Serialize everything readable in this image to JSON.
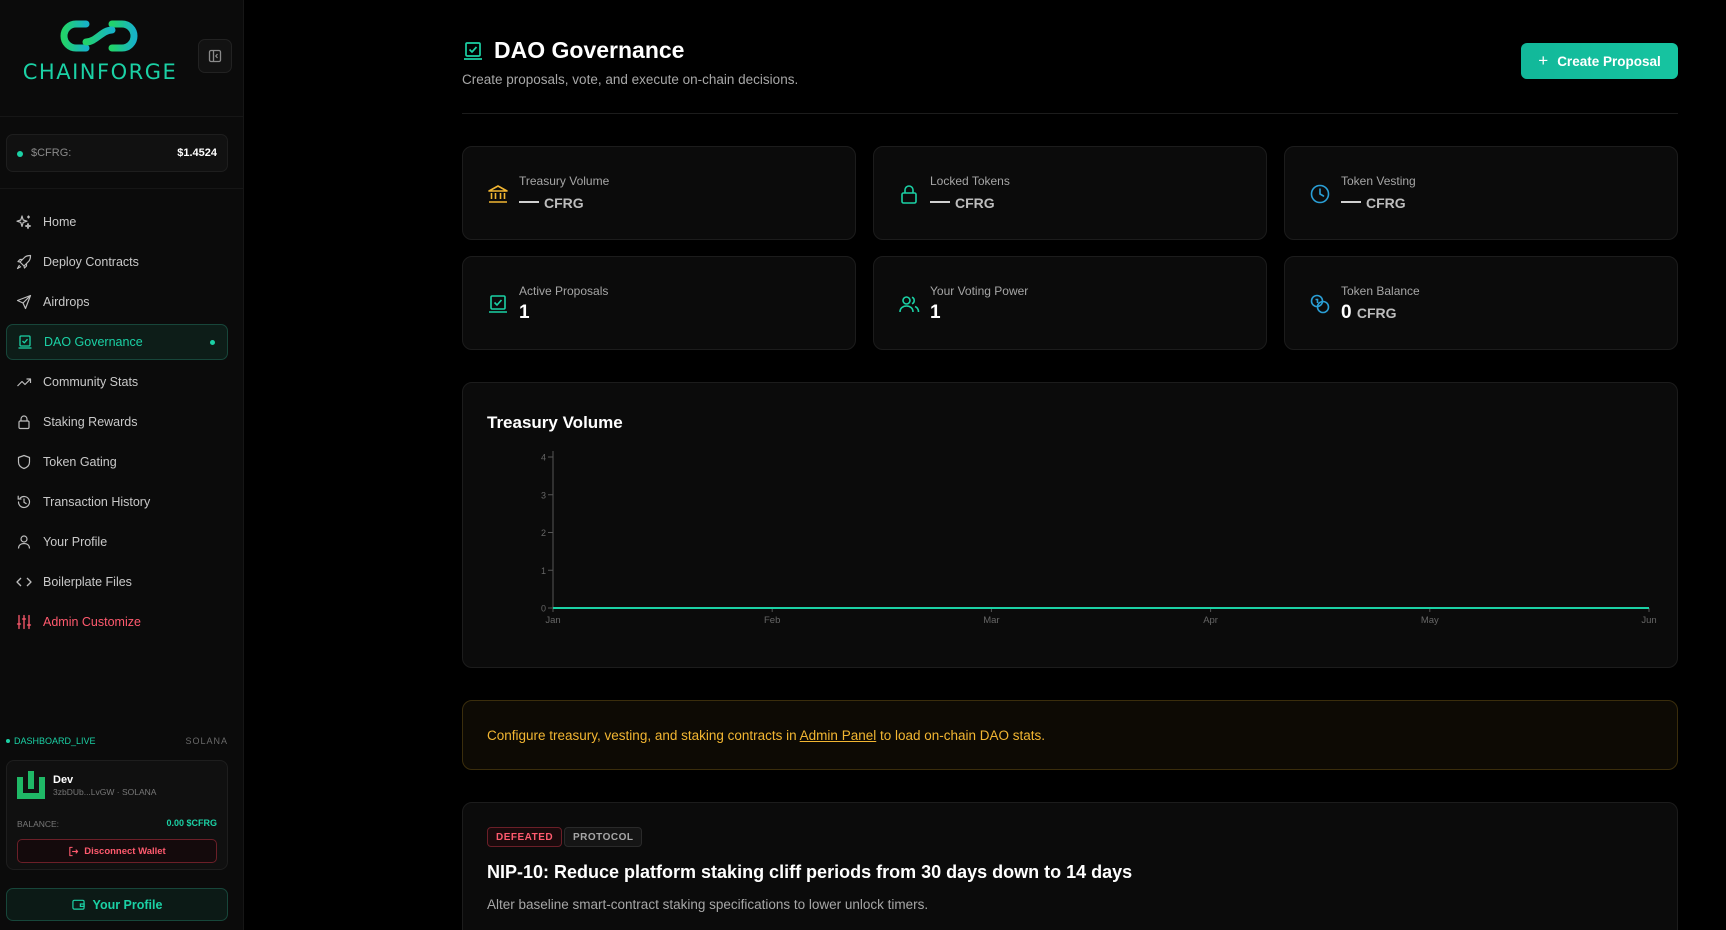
{
  "brand": {
    "name": "CHAINFORGE"
  },
  "price": {
    "label": "$CFRG:",
    "value": "$1.4524"
  },
  "nav": {
    "items": [
      {
        "label": "Home",
        "icon": "sparkles-icon"
      },
      {
        "label": "Deploy Contracts",
        "icon": "rocket-icon"
      },
      {
        "label": "Airdrops",
        "icon": "send-icon"
      },
      {
        "label": "DAO Governance",
        "icon": "vote-icon",
        "active": true
      },
      {
        "label": "Community Stats",
        "icon": "trending-up-icon"
      },
      {
        "label": "Staking Rewards",
        "icon": "lock-icon"
      },
      {
        "label": "Token Gating",
        "icon": "shield-icon"
      },
      {
        "label": "Transaction History",
        "icon": "history-icon"
      },
      {
        "label": "Your Profile",
        "icon": "user-icon"
      },
      {
        "label": "Boilerplate Files",
        "icon": "code-icon"
      },
      {
        "label": "Admin Customize",
        "icon": "sliders-icon"
      }
    ]
  },
  "status": {
    "live": "DASHBOARD_LIVE",
    "chain": "SOLANA"
  },
  "wallet": {
    "name": "Dev",
    "address": "3zbDUb...LvGW · SOLANA",
    "balance_label": "BALANCE:",
    "balance_value": "0.00 $CFRG",
    "disconnect_label": "Disconnect Wallet",
    "profile_label": "Your Profile"
  },
  "header": {
    "title": "DAO Governance",
    "subtitle": "Create proposals, vote, and execute on-chain decisions.",
    "create_label": "Create Proposal"
  },
  "stats": [
    {
      "label": "Treasury Volume",
      "value": "",
      "unit": "CFRG",
      "empty": true,
      "icon": "bank-icon",
      "color": "#f2b632"
    },
    {
      "label": "Locked Tokens",
      "value": "",
      "unit": "CFRG",
      "empty": true,
      "icon": "lock-icon",
      "color": "#1bd1a5"
    },
    {
      "label": "Token Vesting",
      "value": "",
      "unit": "CFRG",
      "empty": true,
      "icon": "clock-icon",
      "color": "#2a9fd6"
    },
    {
      "label": "Active Proposals",
      "value": "1",
      "unit": "",
      "icon": "vote-icon",
      "color": "#1bd1a5"
    },
    {
      "label": "Your Voting Power",
      "value": "1",
      "unit": "",
      "icon": "users-icon",
      "color": "#1bd1a5"
    },
    {
      "label": "Token Balance",
      "value": "0",
      "unit": "CFRG",
      "icon": "coins-icon",
      "color": "#2a9fd6"
    }
  ],
  "chart_data": {
    "type": "line",
    "title": "Treasury Volume",
    "categories": [
      "Jan",
      "Feb",
      "Mar",
      "Apr",
      "May",
      "Jun"
    ],
    "values": [
      0,
      0,
      0,
      0,
      0,
      0
    ],
    "ylim": [
      0,
      4
    ],
    "yticks": [
      0,
      1,
      2,
      3,
      4
    ],
    "xlabel": "",
    "ylabel": "",
    "line_color": "#1bd1a5"
  },
  "notice": {
    "before": "Configure treasury, vesting, and staking contracts in ",
    "link": "Admin Panel",
    "after": " to load on-chain DAO stats."
  },
  "proposal": {
    "status_tag": "DEFEATED",
    "category_tag": "PROTOCOL",
    "title": "NIP-10: Reduce platform staking cliff periods from 30 days down to 14 days",
    "description": "Alter baseline smart-contract staking specifications to lower unlock timers."
  }
}
